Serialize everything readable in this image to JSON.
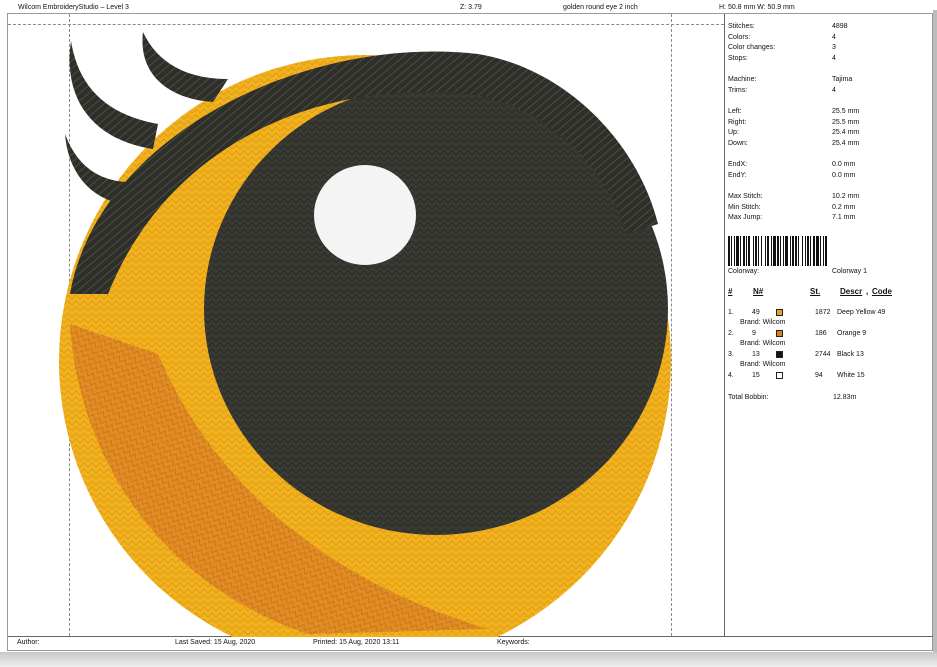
{
  "header": {
    "app_title": "Wilcom EmbroideryStudio – Level 3",
    "zoom": "Z: 3.79",
    "design_name": "golden round eye 2 inch",
    "dimensions": "H: 50.8 mm   W: 50.9 mm"
  },
  "stats": [
    {
      "label": "Stitches:",
      "value": "4898"
    },
    {
      "label": "Colors:",
      "value": "4"
    },
    {
      "label": "Color changes:",
      "value": "3"
    },
    {
      "label": "Stops:",
      "value": "4"
    },
    {
      "label": "Machine:",
      "value": "Tajima"
    },
    {
      "label": "Trims:",
      "value": "4"
    },
    {
      "label": "Left:",
      "value": "25.5 mm"
    },
    {
      "label": "Right:",
      "value": "25.5 mm"
    },
    {
      "label": "Up:",
      "value": "25.4 mm"
    },
    {
      "label": "Down:",
      "value": "25.4 mm"
    },
    {
      "label": "EndX:",
      "value": "0.0 mm"
    },
    {
      "label": "EndY:",
      "value": "0.0 mm"
    },
    {
      "label": "Max Stitch:",
      "value": "10.2 mm"
    },
    {
      "label": "Min Stitch:",
      "value": "0.2 mm"
    },
    {
      "label": "Max Jump:",
      "value": "7.1 mm"
    }
  ],
  "colorway": {
    "label": "Colorway:",
    "value": "Colorway 1"
  },
  "thread_table": {
    "headers": {
      "index": "#",
      "number": "N#",
      "stitches": "St.",
      "descr": "Descr",
      "code": "Code"
    },
    "rows": [
      {
        "index": "1.",
        "number": "49",
        "color": "#e8a020",
        "stitches": "1872",
        "descr": "Deep Yellow 49",
        "brand": "Brand: Wilcom"
      },
      {
        "index": "2.",
        "number": "9",
        "color": "#d9811e",
        "stitches": "186",
        "descr": "Orange 9",
        "brand": "Brand: Wilcom"
      },
      {
        "index": "3.",
        "number": "13",
        "color": "#141414",
        "stitches": "2744",
        "descr": "Black 13",
        "brand": "Brand: Wilcom"
      },
      {
        "index": "4.",
        "number": "15",
        "color": "#ffffff",
        "stitches": "94",
        "descr": "White 15",
        "brand": ""
      }
    ],
    "total_bobbin_label": "Total Bobbin:",
    "total_bobbin_value": "12.83m"
  },
  "footer": {
    "author": "Author:",
    "last_saved": "Last Saved: 15 Aug, 2020",
    "printed": "Printed: 15 Aug, 2020 13:11",
    "keywords": "Keywords:"
  },
  "colors": {
    "deep_yellow": "#f2b21e",
    "orange": "#e08a25",
    "black_thread": "#3a3a35",
    "white_thread": "#f4f4f4"
  }
}
